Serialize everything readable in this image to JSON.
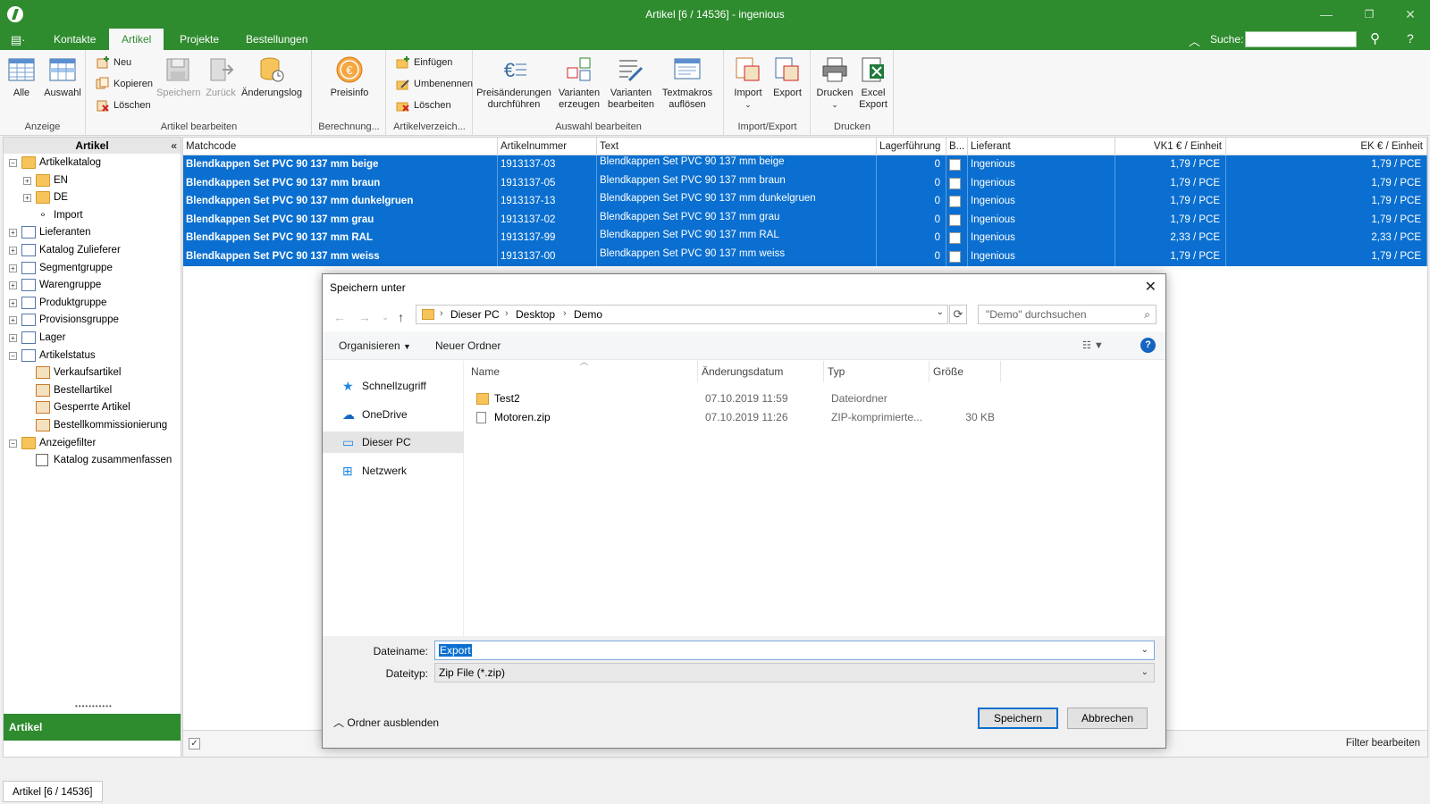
{
  "window": {
    "title": "Artikel [6 / 14536] - ingenious"
  },
  "tabs": [
    "Kontakte",
    "Artikel",
    "Projekte",
    "Bestellungen"
  ],
  "active_tab": "Artikel",
  "search_label": "Suche:",
  "ribbon": {
    "anzeige": {
      "label": "Anzeige",
      "alle": "Alle",
      "auswahl": "Auswahl"
    },
    "artikel_bearbeiten": {
      "label": "Artikel bearbeiten",
      "neu": "Neu",
      "kopieren": "Kopieren",
      "loeschen": "Löschen",
      "speichern": "Speichern",
      "zurueck": "Zurück",
      "aenderungslog": "Änderungslog"
    },
    "berechnung": {
      "label": "Berechnung...",
      "preisinfo": "Preisinfo"
    },
    "artikelverzeichnis": {
      "label": "Artikelverzeich...",
      "einfuegen": "Einfügen",
      "umbenennen": "Umbenennen",
      "loeschen": "Löschen"
    },
    "auswahl_bearbeiten": {
      "label": "Auswahl bearbeiten",
      "preisaenderungen_1": "Preisänderungen",
      "preisaenderungen_2": "durchführen",
      "varianten_erzeugen_1": "Varianten",
      "varianten_erzeugen_2": "erzeugen",
      "varianten_bearbeiten_1": "Varianten",
      "varianten_bearbeiten_2": "bearbeiten",
      "textmakros_1": "Textmakros",
      "textmakros_2": "auflösen"
    },
    "import_export": {
      "label": "Import/Export",
      "import": "Import",
      "export": "Export"
    },
    "drucken": {
      "label": "Drucken",
      "drucken": "Drucken",
      "excel_export_1": "Excel",
      "excel_export_2": "Export"
    }
  },
  "leftpanel": {
    "title": "Artikel",
    "tree": [
      {
        "label": "Artikelkatalog",
        "level": 0,
        "exp": "−",
        "icon": "folder"
      },
      {
        "label": "EN",
        "level": 1,
        "exp": "+",
        "icon": "folder"
      },
      {
        "label": "DE",
        "level": 1,
        "exp": "+",
        "icon": "folder"
      },
      {
        "label": "Import",
        "level": 1,
        "exp": "",
        "icon": "bullet"
      },
      {
        "label": "Lieferanten",
        "level": 0,
        "exp": "+",
        "icon": "catalog"
      },
      {
        "label": "Katalog Zulieferer",
        "level": 0,
        "exp": "+",
        "icon": "catalog"
      },
      {
        "label": "Segmentgruppe",
        "level": 0,
        "exp": "+",
        "icon": "catalog"
      },
      {
        "label": "Warengruppe",
        "level": 0,
        "exp": "+",
        "icon": "catalog"
      },
      {
        "label": "Produktgruppe",
        "level": 0,
        "exp": "+",
        "icon": "catalog"
      },
      {
        "label": "Provisionsgruppe",
        "level": 0,
        "exp": "+",
        "icon": "catalog"
      },
      {
        "label": "Lager",
        "level": 0,
        "exp": "+",
        "icon": "catalog"
      },
      {
        "label": "Artikelstatus",
        "level": 0,
        "exp": "−",
        "icon": "catalog"
      },
      {
        "label": "Verkaufsartikel",
        "level": 1,
        "exp": "",
        "icon": "status"
      },
      {
        "label": "Bestellartikel",
        "level": 1,
        "exp": "",
        "icon": "status"
      },
      {
        "label": "Gesperrte Artikel",
        "level": 1,
        "exp": "",
        "icon": "status"
      },
      {
        "label": "Bestellkommissionierung",
        "level": 1,
        "exp": "",
        "icon": "status"
      },
      {
        "label": "Anzeigefilter",
        "level": 0,
        "exp": "−",
        "icon": "folder"
      },
      {
        "label": "Katalog zusammenfassen",
        "level": 1,
        "exp": "",
        "icon": "checkbox"
      }
    ],
    "nav_artikel": "Artikel"
  },
  "grid": {
    "columns": [
      "Matchcode",
      "Artikelnummer",
      "Text",
      "Lagerführung",
      "B...",
      "Lieferant",
      "VK1 € / Einheit",
      "EK € / Einheit"
    ],
    "rows": [
      {
        "matchcode": "Blendkappen Set PVC 90 137 mm beige",
        "nr": "1913137-03",
        "text": "Blendkappen Set PVC 90 137 mm beige",
        "lager": "0",
        "lieferant": "Ingenious",
        "vk": "1,79 / PCE",
        "ek": "1,79 / PCE"
      },
      {
        "matchcode": "Blendkappen Set PVC 90 137 mm braun",
        "nr": "1913137-05",
        "text": "Blendkappen Set PVC 90 137 mm braun",
        "lager": "0",
        "lieferant": "Ingenious",
        "vk": "1,79 / PCE",
        "ek": "1,79 / PCE"
      },
      {
        "matchcode": "Blendkappen Set PVC 90 137 mm dunkelgruen",
        "nr": "1913137-13",
        "text": "Blendkappen Set PVC 90 137 mm dunkelgruen",
        "lager": "0",
        "lieferant": "Ingenious",
        "vk": "1,79 / PCE",
        "ek": "1,79 / PCE"
      },
      {
        "matchcode": "Blendkappen Set PVC 90 137 mm grau",
        "nr": "1913137-02",
        "text": "Blendkappen Set PVC 90 137 mm grau",
        "lager": "0",
        "lieferant": "Ingenious",
        "vk": "1,79 / PCE",
        "ek": "1,79 / PCE"
      },
      {
        "matchcode": "Blendkappen Set PVC 90 137 mm RAL",
        "nr": "1913137-99",
        "text": "Blendkappen Set PVC 90 137 mm RAL",
        "lager": "0",
        "lieferant": "Ingenious",
        "vk": "2,33 / PCE",
        "ek": "2,33 / PCE"
      },
      {
        "matchcode": "Blendkappen Set PVC 90 137 mm weiss",
        "nr": "1913137-00",
        "text": "Blendkappen Set PVC 90 137 mm weiss",
        "lager": "0",
        "lieferant": "Ingenious",
        "vk": "1,79 / PCE",
        "ek": "1,79 / PCE"
      }
    ],
    "filter_edit": "Filter bearbeiten"
  },
  "statusbar": {
    "text": "Artikel [6 / 14536]"
  },
  "dialog": {
    "title": "Speichern unter",
    "breadcrumb": [
      "Dieser PC",
      "Desktop",
      "Demo"
    ],
    "search_placeholder": "\"Demo\" durchsuchen",
    "organize": "Organisieren",
    "new_folder": "Neuer Ordner",
    "nav": [
      "Schnellzugriff",
      "OneDrive",
      "Dieser PC",
      "Netzwerk"
    ],
    "nav_selected": "Dieser PC",
    "columns": [
      "Name",
      "Änderungsdatum",
      "Typ",
      "Größe"
    ],
    "files": [
      {
        "name": "Test2",
        "date": "07.10.2019 11:59",
        "type": "Dateiordner",
        "size": ""
      },
      {
        "name": "Motoren.zip",
        "date": "07.10.2019 11:26",
        "type": "ZIP-komprimierte...",
        "size": "30 KB"
      }
    ],
    "filename_label": "Dateiname:",
    "filename_value": "Export",
    "filetype_label": "Dateityp:",
    "filetype_value": "Zip File (*.zip)",
    "hide_folders": "Ordner ausblenden",
    "save": "Speichern",
    "cancel": "Abbrechen"
  },
  "colors": {
    "brand_green": "#2e8b2e",
    "selection_blue": "#0a6fd0"
  }
}
